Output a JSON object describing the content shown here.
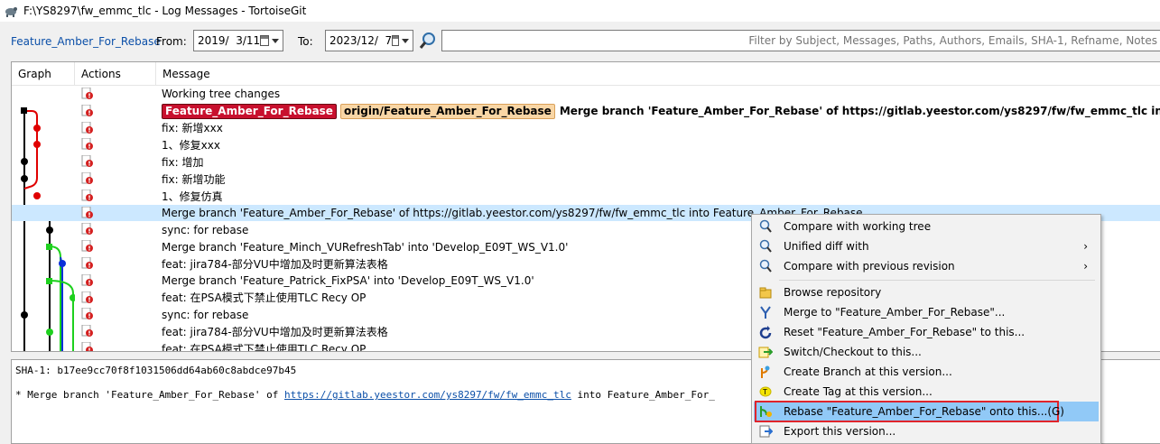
{
  "window": {
    "title": "F:\\YS8297\\fw_emmc_tlc - Log Messages - TortoiseGit"
  },
  "filter": {
    "branch": "Feature_Amber_For_Rebase",
    "from_label": "From:",
    "from_date": "2019/  3/11",
    "to_label": "To:",
    "to_date": "2023/12/  7",
    "search_placeholder": "Filter by Subject, Messages, Paths, Authors, Emails, SHA-1, Refname, Notes"
  },
  "columns": {
    "graph": "Graph",
    "actions": "Actions",
    "message": "Message"
  },
  "refs": {
    "local": "Feature_Amber_For_Rebase",
    "remote": "origin/Feature_Amber_For_Rebase"
  },
  "rows": [
    {
      "message": "Working tree changes"
    },
    {
      "message": "Merge branch 'Feature_Amber_For_Rebase' of https://gitlab.yeestor.com/ys8297/fw/fw_emmc_tlc into Feature_Amber_For_Rebase"
    },
    {
      "message": "fix: 新增xxx"
    },
    {
      "message": "1、修复xxx"
    },
    {
      "message": "fix: 增加"
    },
    {
      "message": "fix: 新增功能"
    },
    {
      "message": "1、修复仿真"
    },
    {
      "message": "Merge branch 'Feature_Amber_For_Rebase' of https://gitlab.yeestor.com/ys8297/fw/fw_emmc_tlc into Feature_Amber_For_Rebase"
    },
    {
      "message": "sync: for rebase"
    },
    {
      "message": "Merge branch 'Feature_Minch_VURefreshTab' into 'Develop_E09T_WS_V1.0'"
    },
    {
      "message": "feat: jira784-部分VU中增加及时更新算法表格"
    },
    {
      "message": "Merge branch 'Feature_Patrick_FixPSA' into 'Develop_E09T_WS_V1.0'"
    },
    {
      "message": "feat: 在PSA模式下禁止使用TLC Recy OP"
    },
    {
      "message": "sync: for rebase"
    },
    {
      "message": "feat: jira784-部分VU中增加及时更新算法表格"
    },
    {
      "message": "feat: 在PSA模式下禁止使用TLC Recy OP"
    }
  ],
  "detail": {
    "sha": "SHA-1: b17ee9cc70f8f1031506dd64ab60c8abdce97b45",
    "prefix": "* Merge branch 'Feature_Amber_For_Rebase' of ",
    "url": "https://gitlab.yeestor.com/ys8297/fw/fw_emmc_tlc",
    "suffix": " into Feature_Amber_For_"
  },
  "menu": {
    "compare_working_tree": "Compare with working tree",
    "unified_diff": "Unified diff with",
    "compare_previous": "Compare with previous revision",
    "browse_repo": "Browse repository",
    "merge_to": "Merge to \"Feature_Amber_For_Rebase\"...",
    "reset": "Reset \"Feature_Amber_For_Rebase\" to this...",
    "switch_checkout": "Switch/Checkout to this...",
    "create_branch": "Create Branch at this version...",
    "create_tag": "Create Tag at this version...",
    "rebase": "Rebase \"Feature_Amber_For_Rebase\" onto this...(G)",
    "export": "Export this version..."
  },
  "colors": {
    "selection": "#cce8ff",
    "menu_highlight": "#91c9f7",
    "highlight_box": "#e0242b",
    "local_branch": "#c8102e",
    "remote_branch": "#f9d6a5"
  }
}
